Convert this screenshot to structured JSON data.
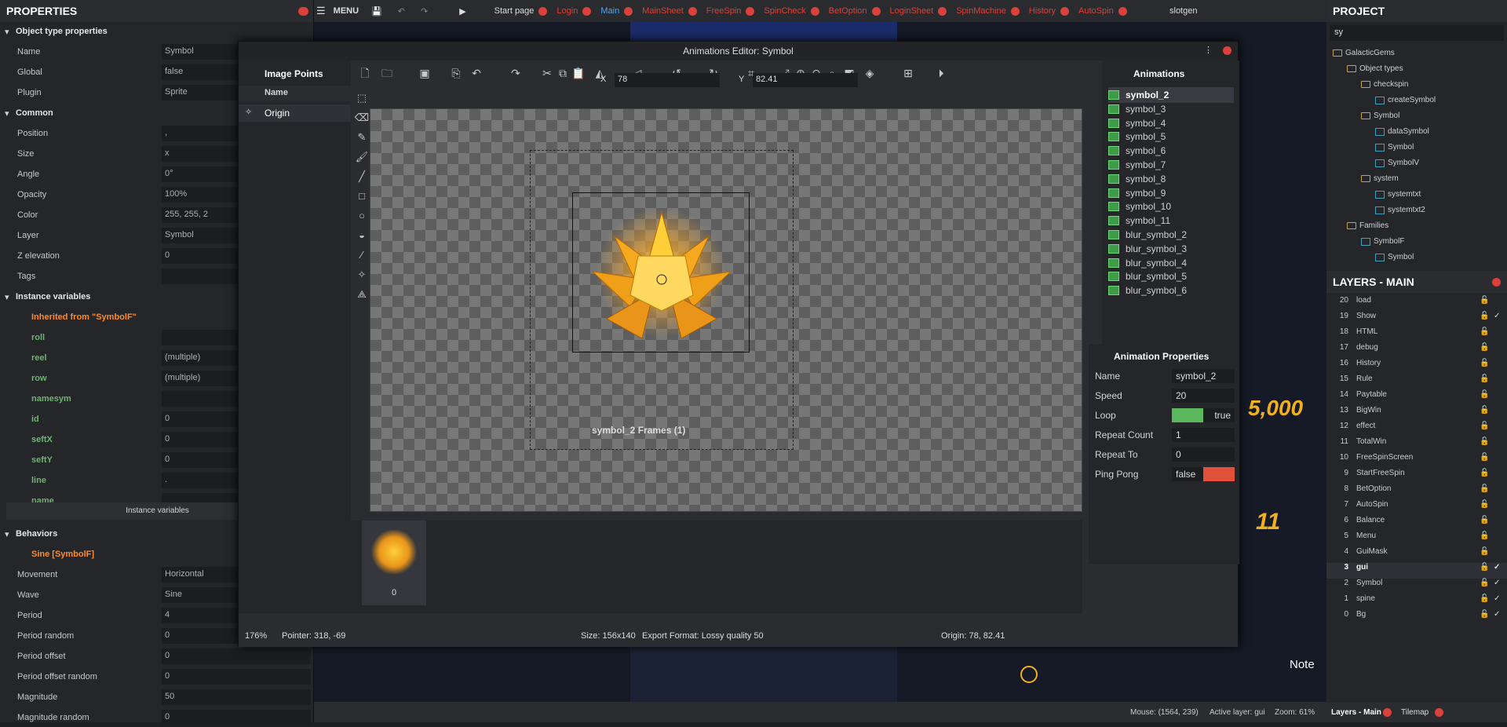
{
  "properties": {
    "title": "PROPERTIES",
    "rows": [
      {
        "label": "Object type properties",
        "value": "",
        "type": "section"
      },
      {
        "label": "Name",
        "value": "Symbol"
      },
      {
        "label": "Global",
        "value": "false"
      },
      {
        "label": "Plugin",
        "value": "Sprite"
      },
      {
        "label": "Common",
        "value": "",
        "type": "section"
      },
      {
        "label": "Position",
        "value": ","
      },
      {
        "label": "Size",
        "value": "x"
      },
      {
        "label": "Angle",
        "value": "0°"
      },
      {
        "label": "Opacity",
        "value": "100%"
      },
      {
        "label": "Color",
        "value": "255, 255, 2"
      },
      {
        "label": "Layer",
        "value": "Symbol"
      },
      {
        "label": "Z elevation",
        "value": "0"
      },
      {
        "label": "Tags",
        "value": ""
      },
      {
        "label": "Instance variables",
        "value": "",
        "type": "section"
      },
      {
        "label": "Inherited from \"SymbolF\"",
        "value": "",
        "type": "orange"
      },
      {
        "label": "roll",
        "value": "",
        "type": "green"
      },
      {
        "label": "reel",
        "value": "(multiple)",
        "type": "green"
      },
      {
        "label": "row",
        "value": "(multiple)",
        "type": "green"
      },
      {
        "label": "namesym",
        "value": "",
        "type": "green"
      },
      {
        "label": "id",
        "value": "0",
        "type": "green"
      },
      {
        "label": "seftX",
        "value": "0",
        "type": "green"
      },
      {
        "label": "seftY",
        "value": "0",
        "type": "green"
      },
      {
        "label": "line",
        "value": ".",
        "type": "green"
      },
      {
        "label": "name",
        "value": "",
        "type": "green"
      }
    ],
    "instance_vars_button": "Instance variables",
    "behaviors": [
      {
        "label": "Behaviors",
        "value": "",
        "type": "section"
      },
      {
        "label": "Sine [SymbolF]",
        "value": "",
        "type": "orange"
      },
      {
        "label": "Movement",
        "value": "Horizontal"
      },
      {
        "label": "Wave",
        "value": "Sine"
      },
      {
        "label": "Period",
        "value": "4"
      },
      {
        "label": "Period random",
        "value": "0"
      },
      {
        "label": "Period offset",
        "value": "0"
      },
      {
        "label": "Period offset random",
        "value": "0"
      },
      {
        "label": "Magnitude",
        "value": "50"
      },
      {
        "label": "Magnitude random",
        "value": "0"
      }
    ]
  },
  "topbar": {
    "menu": "MENU",
    "tabs": [
      "Start page",
      "Login",
      "Main",
      "MainSheet",
      "FreeSpin",
      "SpinCheck",
      "BetOption",
      "LoginSheet",
      "SpinMachine",
      "History",
      "AutoSpin"
    ],
    "user": "slotgen"
  },
  "editor": {
    "title": "Animations Editor: Symbol",
    "image_points": {
      "title": "Image Points",
      "col": "Name",
      "item": "Origin"
    },
    "x_label": "X",
    "x_value": "78",
    "y_label": "Y",
    "y_value": "82.41",
    "frames_title": "symbol_2 Frames (1)",
    "frame_index": "0",
    "status": {
      "zoom": "176%",
      "pointer": "Pointer: 318, -69",
      "size": "Size: 156x140",
      "export": "Export Format: Lossy quality 50",
      "origin": "Origin: 78, 82.41"
    }
  },
  "animations": {
    "title": "Animations",
    "items": [
      "symbol_2",
      "symbol_3",
      "symbol_4",
      "symbol_5",
      "symbol_6",
      "symbol_7",
      "symbol_8",
      "symbol_9",
      "symbol_10",
      "symbol_11",
      "blur_symbol_2",
      "blur_symbol_3",
      "blur_symbol_4",
      "blur_symbol_5",
      "blur_symbol_6"
    ]
  },
  "anim_props": {
    "title": "Animation Properties",
    "rows": [
      {
        "label": "Name",
        "value": "symbol_2"
      },
      {
        "label": "Speed",
        "value": "20"
      },
      {
        "label": "Loop",
        "value": "true"
      },
      {
        "label": "Repeat Count",
        "value": "1"
      },
      {
        "label": "Repeat To",
        "value": "0"
      },
      {
        "label": "Ping Pong",
        "value": "false"
      }
    ]
  },
  "project": {
    "title": "PROJECT",
    "search": "sy",
    "tree": [
      {
        "label": "GalacticGems",
        "level": 0,
        "kind": "folder"
      },
      {
        "label": "Object types",
        "level": 1,
        "kind": "folder"
      },
      {
        "label": "checkspin",
        "level": 2,
        "kind": "folder"
      },
      {
        "label": "createSymbol",
        "level": 3,
        "kind": "item"
      },
      {
        "label": "Symbol",
        "level": 2,
        "kind": "folder"
      },
      {
        "label": "dataSymbol",
        "level": 3,
        "kind": "item"
      },
      {
        "label": "Symbol",
        "level": 3,
        "kind": "item"
      },
      {
        "label": "SymbolV",
        "level": 3,
        "kind": "item"
      },
      {
        "label": "system",
        "level": 2,
        "kind": "folder"
      },
      {
        "label": "systemtxt",
        "level": 3,
        "kind": "item"
      },
      {
        "label": "systemtxt2",
        "level": 3,
        "kind": "item"
      },
      {
        "label": "Families",
        "level": 1,
        "kind": "folder"
      },
      {
        "label": "SymbolF",
        "level": 2,
        "kind": "item"
      },
      {
        "label": "Symbol",
        "level": 3,
        "kind": "item"
      }
    ]
  },
  "layers": {
    "title": "LAYERS - MAIN",
    "items": [
      {
        "n": "20",
        "name": "load",
        "check": ""
      },
      {
        "n": "19",
        "name": "Show",
        "check": "✓"
      },
      {
        "n": "18",
        "name": "HTML",
        "check": ""
      },
      {
        "n": "17",
        "name": "debug",
        "check": ""
      },
      {
        "n": "16",
        "name": "History",
        "check": ""
      },
      {
        "n": "15",
        "name": "Rule",
        "check": ""
      },
      {
        "n": "14",
        "name": "Paytable",
        "check": ""
      },
      {
        "n": "13",
        "name": "BigWin",
        "check": ""
      },
      {
        "n": "12",
        "name": "effect",
        "check": ""
      },
      {
        "n": "11",
        "name": "TotalWin",
        "check": ""
      },
      {
        "n": "10",
        "name": "FreeSpinScreen",
        "check": ""
      },
      {
        "n": "9",
        "name": "StartFreeSpin",
        "check": ""
      },
      {
        "n": "8",
        "name": "BetOption",
        "check": ""
      },
      {
        "n": "7",
        "name": "AutoSpin",
        "check": ""
      },
      {
        "n": "6",
        "name": "Balance",
        "check": ""
      },
      {
        "n": "5",
        "name": "Menu",
        "check": ""
      },
      {
        "n": "4",
        "name": "GuiMask",
        "check": ""
      },
      {
        "n": "3",
        "name": "gui",
        "check": "✓"
      },
      {
        "n": "2",
        "name": "Symbol",
        "check": "✓"
      },
      {
        "n": "1",
        "name": "spine",
        "check": "✓"
      },
      {
        "n": "0",
        "name": "Bg",
        "check": "✓"
      }
    ],
    "bottom_tabs": [
      "Layers - Main",
      "Tilemap"
    ]
  },
  "layout_view": {
    "score": "5,000",
    "eleven": "11",
    "note": "Note",
    "status": "Mouse: (1564, 239)",
    "active_layer": "Active layer: gui",
    "zoom": "Zoom: 61%"
  }
}
